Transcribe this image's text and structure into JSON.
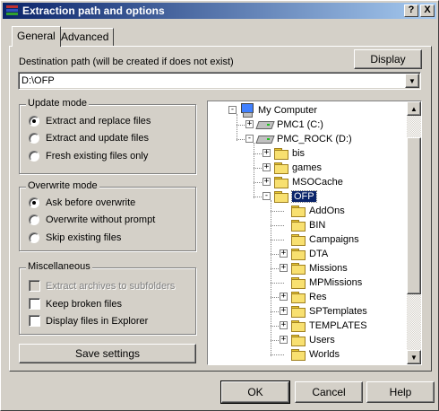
{
  "window": {
    "title": "Extraction path and options",
    "help_button": "?",
    "close_button": "X"
  },
  "tabs": [
    {
      "label": "General",
      "active": true
    },
    {
      "label": "Advanced",
      "active": false
    }
  ],
  "destination": {
    "label": "Destination path (will be created if does not exist)",
    "value": "D:\\OFP",
    "display_button": "Display"
  },
  "update_mode": {
    "title": "Update mode",
    "options": [
      {
        "label": "Extract and replace files",
        "selected": true
      },
      {
        "label": "Extract and update files",
        "selected": false
      },
      {
        "label": "Fresh existing files only",
        "selected": false
      }
    ]
  },
  "overwrite_mode": {
    "title": "Overwrite mode",
    "options": [
      {
        "label": "Ask before overwrite",
        "selected": true
      },
      {
        "label": "Overwrite without prompt",
        "selected": false
      },
      {
        "label": "Skip existing files",
        "selected": false
      }
    ]
  },
  "miscellaneous": {
    "title": "Miscellaneous",
    "options": [
      {
        "label": "Extract archives to subfolders",
        "checked": false,
        "enabled": false
      },
      {
        "label": "Keep broken files",
        "checked": false,
        "enabled": true
      },
      {
        "label": "Display files in Explorer",
        "checked": false,
        "enabled": true
      }
    ]
  },
  "save_settings_button": "Save settings",
  "tree": {
    "items": [
      {
        "label": "My Computer",
        "icon": "computer-icon",
        "level": 0,
        "expander": "-"
      },
      {
        "label": "PMC1 (C:)",
        "icon": "drive-icon",
        "level": 1,
        "expander": "+"
      },
      {
        "label": "PMC_ROCK (D:)",
        "icon": "drive-icon",
        "level": 1,
        "expander": "-"
      },
      {
        "label": "bis",
        "icon": "folder-icon",
        "level": 2,
        "expander": "+"
      },
      {
        "label": "games",
        "icon": "folder-icon",
        "level": 2,
        "expander": "+"
      },
      {
        "label": "MSOCache",
        "icon": "folder-icon",
        "level": 2,
        "expander": "+"
      },
      {
        "label": "OFP",
        "icon": "folder-open-icon",
        "level": 2,
        "expander": "-",
        "selected": true
      },
      {
        "label": "AddOns",
        "icon": "folder-icon",
        "level": 3,
        "expander": ""
      },
      {
        "label": "BIN",
        "icon": "folder-icon",
        "level": 3,
        "expander": ""
      },
      {
        "label": "Campaigns",
        "icon": "folder-icon",
        "level": 3,
        "expander": ""
      },
      {
        "label": "DTA",
        "icon": "folder-icon",
        "level": 3,
        "expander": "+"
      },
      {
        "label": "Missions",
        "icon": "folder-icon",
        "level": 3,
        "expander": "+"
      },
      {
        "label": "MPMissions",
        "icon": "folder-icon",
        "level": 3,
        "expander": ""
      },
      {
        "label": "Res",
        "icon": "folder-icon",
        "level": 3,
        "expander": "+"
      },
      {
        "label": "SPTemplates",
        "icon": "folder-icon",
        "level": 3,
        "expander": "+"
      },
      {
        "label": "TEMPLATES",
        "icon": "folder-icon",
        "level": 3,
        "expander": "+"
      },
      {
        "label": "Users",
        "icon": "folder-icon",
        "level": 3,
        "expander": "+"
      },
      {
        "label": "Worlds",
        "icon": "folder-icon",
        "level": 3,
        "expander": ""
      }
    ]
  },
  "footer": {
    "ok": "OK",
    "cancel": "Cancel",
    "help": "Help"
  },
  "colors": {
    "face": "#d4d0c8",
    "title_start": "#0a246a",
    "title_end": "#a6caf0",
    "selection": "#0a246a"
  }
}
